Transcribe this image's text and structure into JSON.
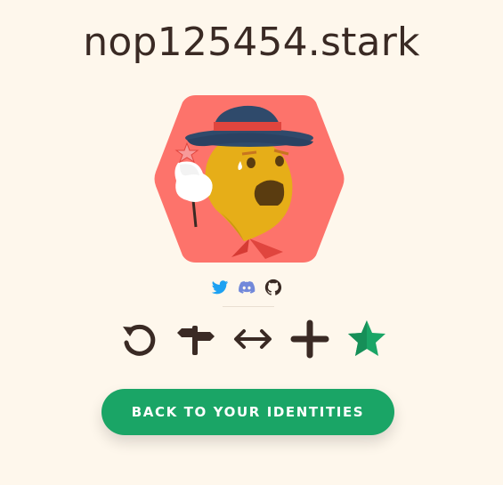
{
  "identity": {
    "name": "nop125454.stark"
  },
  "social": {
    "links": [
      "twitter",
      "discord",
      "github"
    ]
  },
  "colors": {
    "background": "#fef7ec",
    "hexagon": "#fd736b",
    "button": "#1aa566",
    "icon_dark": "#3a2a24",
    "twitter": "#1da1f2",
    "discord": "#7289da",
    "star": "#1aa566"
  },
  "actions": {
    "icons": [
      "refresh-icon",
      "signpost-icon",
      "transfer-icon",
      "plus-icon",
      "star-icon"
    ]
  },
  "cta": {
    "label": "BACK TO YOUR IDENTITIES"
  }
}
